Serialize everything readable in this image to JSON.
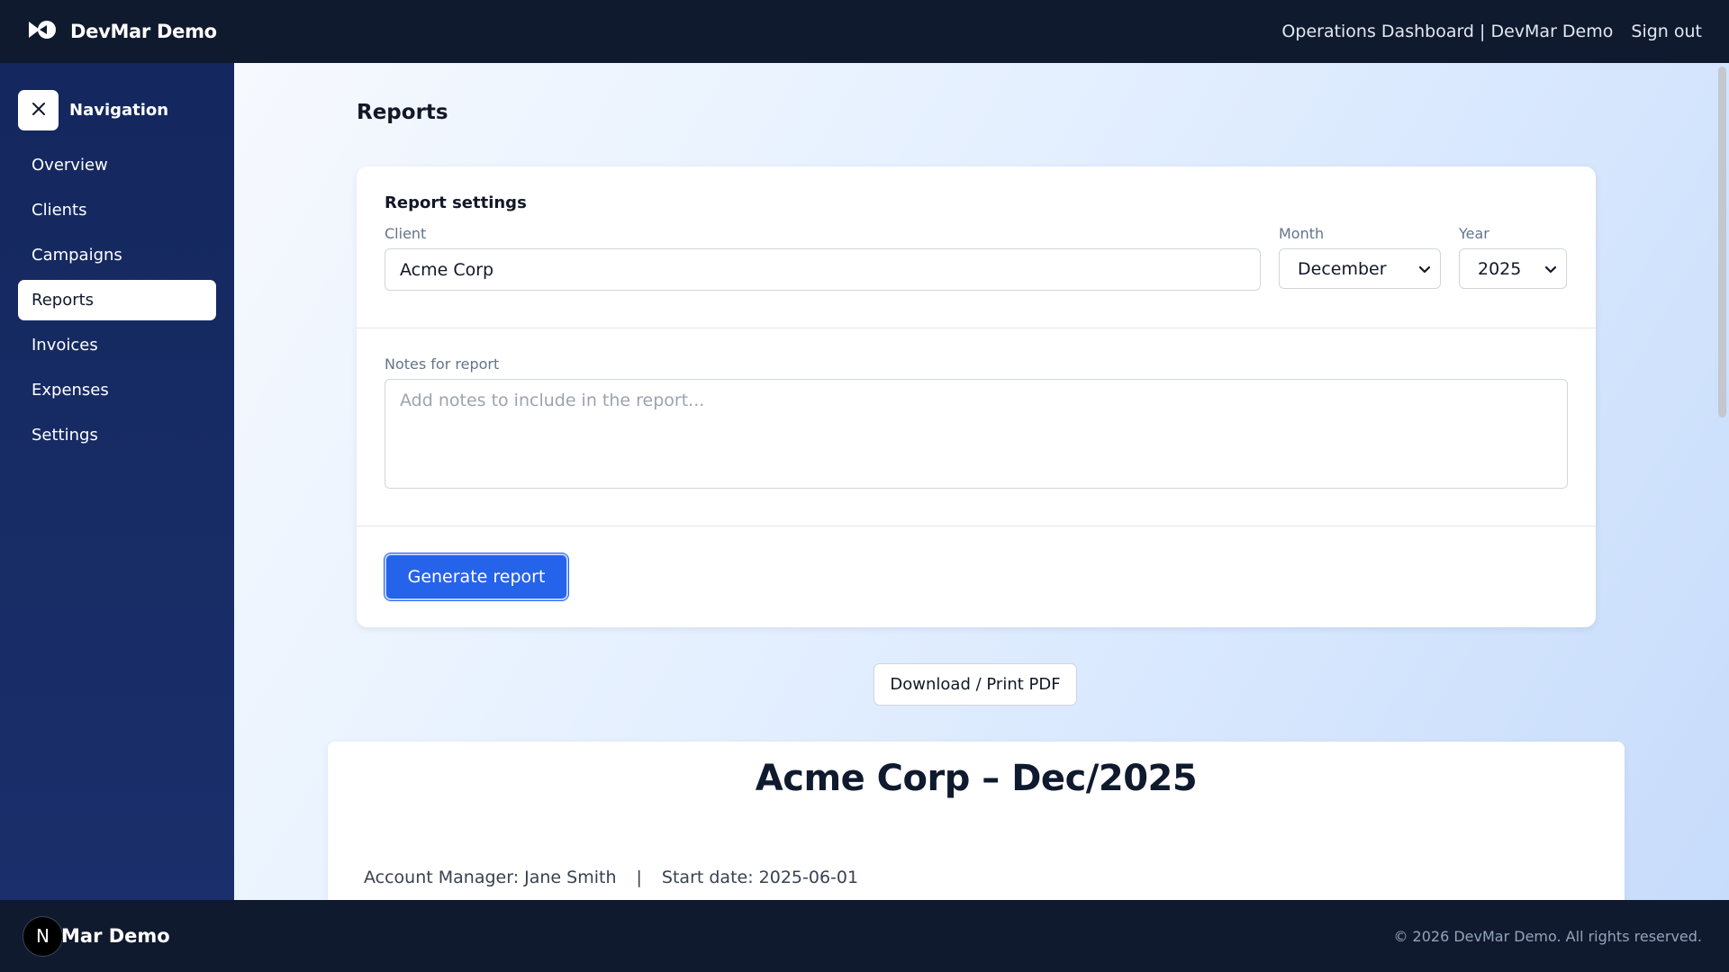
{
  "header": {
    "brand": "DevMar Demo",
    "context": "Operations Dashboard | DevMar Demo",
    "signout": "Sign out"
  },
  "sidebar": {
    "title": "Navigation",
    "items": [
      {
        "label": "Overview"
      },
      {
        "label": "Clients"
      },
      {
        "label": "Campaigns"
      },
      {
        "label": "Reports",
        "active": true
      },
      {
        "label": "Invoices"
      },
      {
        "label": "Expenses"
      },
      {
        "label": "Settings"
      }
    ]
  },
  "main": {
    "page_title": "Reports",
    "settings": {
      "heading": "Report settings",
      "client_label": "Client",
      "client_value": "Acme Corp",
      "month_label": "Month",
      "month_value": "December",
      "year_label": "Year",
      "year_value": "2025",
      "notes_label": "Notes for report",
      "notes_placeholder": "Add notes to include in the report...",
      "generate_label": "Generate report"
    },
    "download_label": "Download / Print PDF",
    "report": {
      "title": "Acme Corp – Dec/2025",
      "account_manager": "Account Manager: Jane Smith",
      "separator": "|",
      "start_date": "Start date: 2025-06-01"
    }
  },
  "footer": {
    "avatar_letter": "N",
    "brand": "Mar Demo",
    "copyright": "© 2026 DevMar Demo. All rights reserved."
  },
  "colors": {
    "primary": "#2563eb",
    "navy": "#0f1a2e",
    "sidebar": "#14275e"
  }
}
